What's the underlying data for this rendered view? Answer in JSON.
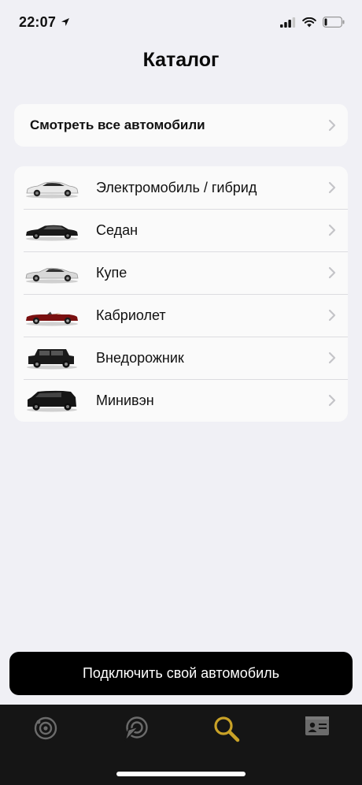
{
  "status": {
    "time": "22:07",
    "battery_level": 0.15
  },
  "header": {
    "title": "Каталог"
  },
  "all_cars": {
    "label": "Смотреть все автомобили"
  },
  "car_types": [
    {
      "label": "Электромобиль / гибрид",
      "car_color": "#e9e9e9",
      "icon": "electric-car-icon"
    },
    {
      "label": "Седан",
      "car_color": "#1a1a1a",
      "icon": "sedan-car-icon"
    },
    {
      "label": "Купе",
      "car_color": "#d8d8d8",
      "icon": "coupe-car-icon"
    },
    {
      "label": "Кабриолет",
      "car_color": "#7a1010",
      "icon": "cabriolet-car-icon"
    },
    {
      "label": "Внедорожник",
      "car_color": "#1a1a1a",
      "icon": "suv-car-icon"
    },
    {
      "label": "Минивэн",
      "car_color": "#151515",
      "icon": "minivan-car-icon"
    }
  ],
  "connect_button": {
    "label": "Подключить свой автомобиль"
  },
  "tab_bar": {
    "tabs": [
      {
        "icon": "orbit-icon",
        "active": false
      },
      {
        "icon": "navigation-icon",
        "active": false
      },
      {
        "icon": "search-icon",
        "active": true
      },
      {
        "icon": "profile-card-icon",
        "active": false
      }
    ],
    "active_color": "#c9a227",
    "inactive_color": "#6b6b6b"
  }
}
